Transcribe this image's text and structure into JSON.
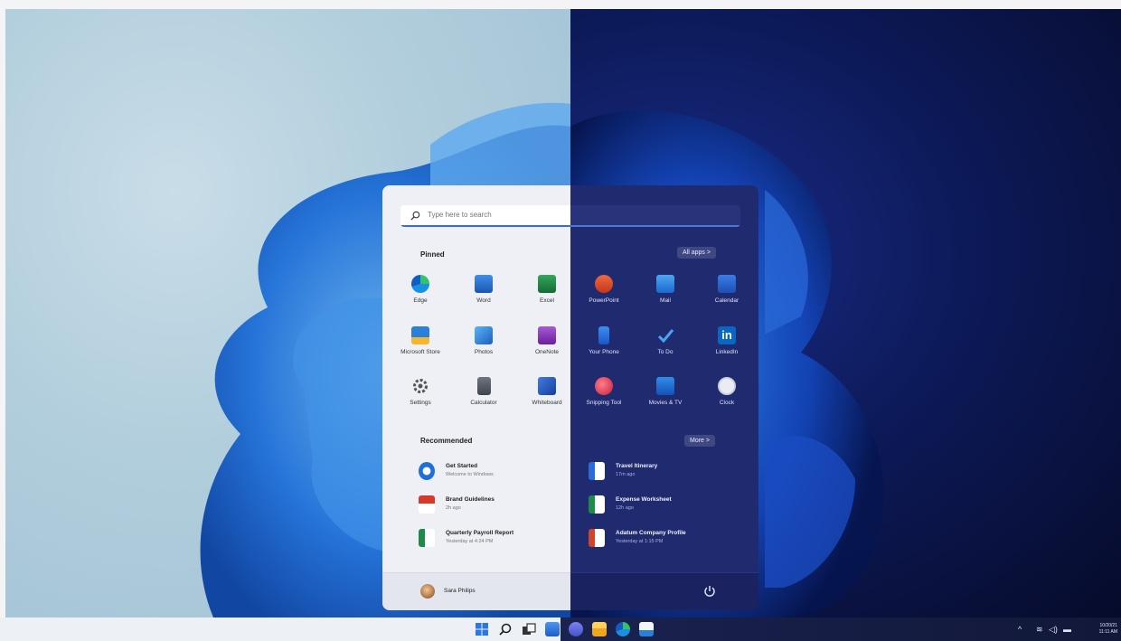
{
  "search": {
    "placeholder": "Type here to search"
  },
  "pinned": {
    "title": "Pinned",
    "all_apps_label": "All apps  >",
    "apps": [
      {
        "label": "Edge",
        "icon": "edge-icon"
      },
      {
        "label": "Word",
        "icon": "word-icon"
      },
      {
        "label": "Excel",
        "icon": "excel-icon"
      },
      {
        "label": "PowerPoint",
        "icon": "powerpoint-icon"
      },
      {
        "label": "Mail",
        "icon": "mail-icon"
      },
      {
        "label": "Calendar",
        "icon": "calendar-icon"
      },
      {
        "label": "Microsoft Store",
        "icon": "store-icon"
      },
      {
        "label": "Photos",
        "icon": "photos-icon"
      },
      {
        "label": "OneNote",
        "icon": "onenote-icon"
      },
      {
        "label": "Your Phone",
        "icon": "phone-icon"
      },
      {
        "label": "To Do",
        "icon": "todo-icon"
      },
      {
        "label": "LinkedIn",
        "icon": "linkedin-icon"
      },
      {
        "label": "Settings",
        "icon": "gear-icon"
      },
      {
        "label": "Calculator",
        "icon": "calculator-icon"
      },
      {
        "label": "Whiteboard",
        "icon": "whiteboard-icon"
      },
      {
        "label": "Snipping Tool",
        "icon": "snipping-icon"
      },
      {
        "label": "Movies & TV",
        "icon": "movies-icon"
      },
      {
        "label": "Clock",
        "icon": "clock-icon"
      }
    ]
  },
  "recommended": {
    "title": "Recommended",
    "more_label": "More  >",
    "items": [
      {
        "title": "Get Started",
        "subtitle": "Welcome to Windows",
        "icon": "get-started-icon"
      },
      {
        "title": "Travel Itinerary",
        "subtitle": "17m ago",
        "icon": "word-doc-icon"
      },
      {
        "title": "Brand Guidelines",
        "subtitle": "2h ago",
        "icon": "pdf-icon"
      },
      {
        "title": "Expense Worksheet",
        "subtitle": "12h ago",
        "icon": "excel-doc-icon"
      },
      {
        "title": "Quarterly Payroll Report",
        "subtitle": "Yesterday at 4:24 PM",
        "icon": "excel-doc-icon"
      },
      {
        "title": "Adatum Company Profile",
        "subtitle": "Yesterday at 1:15 PM",
        "icon": "powerpoint-doc-icon"
      }
    ]
  },
  "user": {
    "name": "Sara Philips"
  },
  "taskbar": {
    "icons": [
      "windows-start-icon",
      "search-icon",
      "task-view-icon",
      "widgets-icon",
      "chat-icon",
      "file-explorer-icon",
      "edge-icon",
      "store-icon"
    ]
  },
  "tray": {
    "date": "10/20/21",
    "time": "11:11 AM"
  },
  "colors": {
    "accent": "#2f6ee0",
    "dark_panel": "#202a6e",
    "light_panel": "#eef0f5"
  }
}
